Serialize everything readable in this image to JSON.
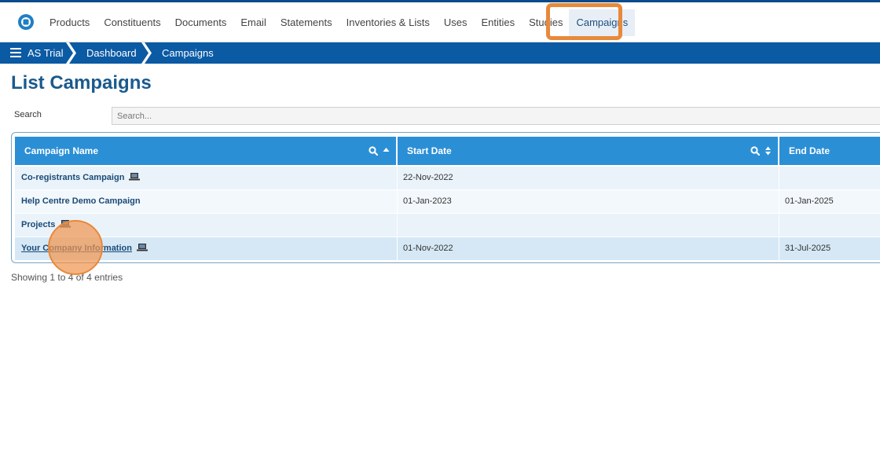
{
  "colors": {
    "brand_dark": "#0b4a8b",
    "crumb_bar": "#0b5aa4",
    "header_blue": "#2b8fd6",
    "title_blue": "#1a5a8e",
    "highlight_orange": "#e8893a",
    "row_odd": "#eaf3fa",
    "row_even": "#f3f8fc",
    "row_hover": "#d6e8f5"
  },
  "topnav": {
    "logo_icon": "app-logo-icon",
    "items": [
      {
        "label": "Products"
      },
      {
        "label": "Constituents"
      },
      {
        "label": "Documents"
      },
      {
        "label": "Email"
      },
      {
        "label": "Statements"
      },
      {
        "label": "Inventories & Lists"
      },
      {
        "label": "Uses"
      },
      {
        "label": "Entities"
      },
      {
        "label": "Studies"
      },
      {
        "label": "Campaigns",
        "active": true
      }
    ]
  },
  "breadcrumb": {
    "menu_icon": "hamburger-icon",
    "items": [
      "AS Trial",
      "Dashboard",
      "Campaigns"
    ]
  },
  "page": {
    "title": "List Campaigns"
  },
  "search": {
    "label": "Search",
    "placeholder": "Search..."
  },
  "table": {
    "columns": [
      {
        "label": "Campaign Name",
        "icons": [
          "search-icon",
          "sort-asc-icon"
        ]
      },
      {
        "label": "Start Date",
        "icons": [
          "search-icon",
          "sort-both-icon"
        ]
      },
      {
        "label": "End Date",
        "icons": []
      }
    ],
    "rows": [
      {
        "name": "Co-registrants Campaign",
        "icon": "laptop-icon",
        "start": "22-Nov-2022",
        "end": ""
      },
      {
        "name": "Help Centre Demo Campaign",
        "icon": "",
        "start": "01-Jan-2023",
        "end": "01-Jan-2025"
      },
      {
        "name": "Projects",
        "icon": "laptop-icon",
        "start": "",
        "end": ""
      },
      {
        "name": "Your Company Information",
        "icon": "laptop-icon",
        "start": "01-Nov-2022",
        "end": "31-Jul-2025",
        "hover": true
      }
    ]
  },
  "footer": {
    "info": "Showing 1 to 4 of 4 entries"
  }
}
